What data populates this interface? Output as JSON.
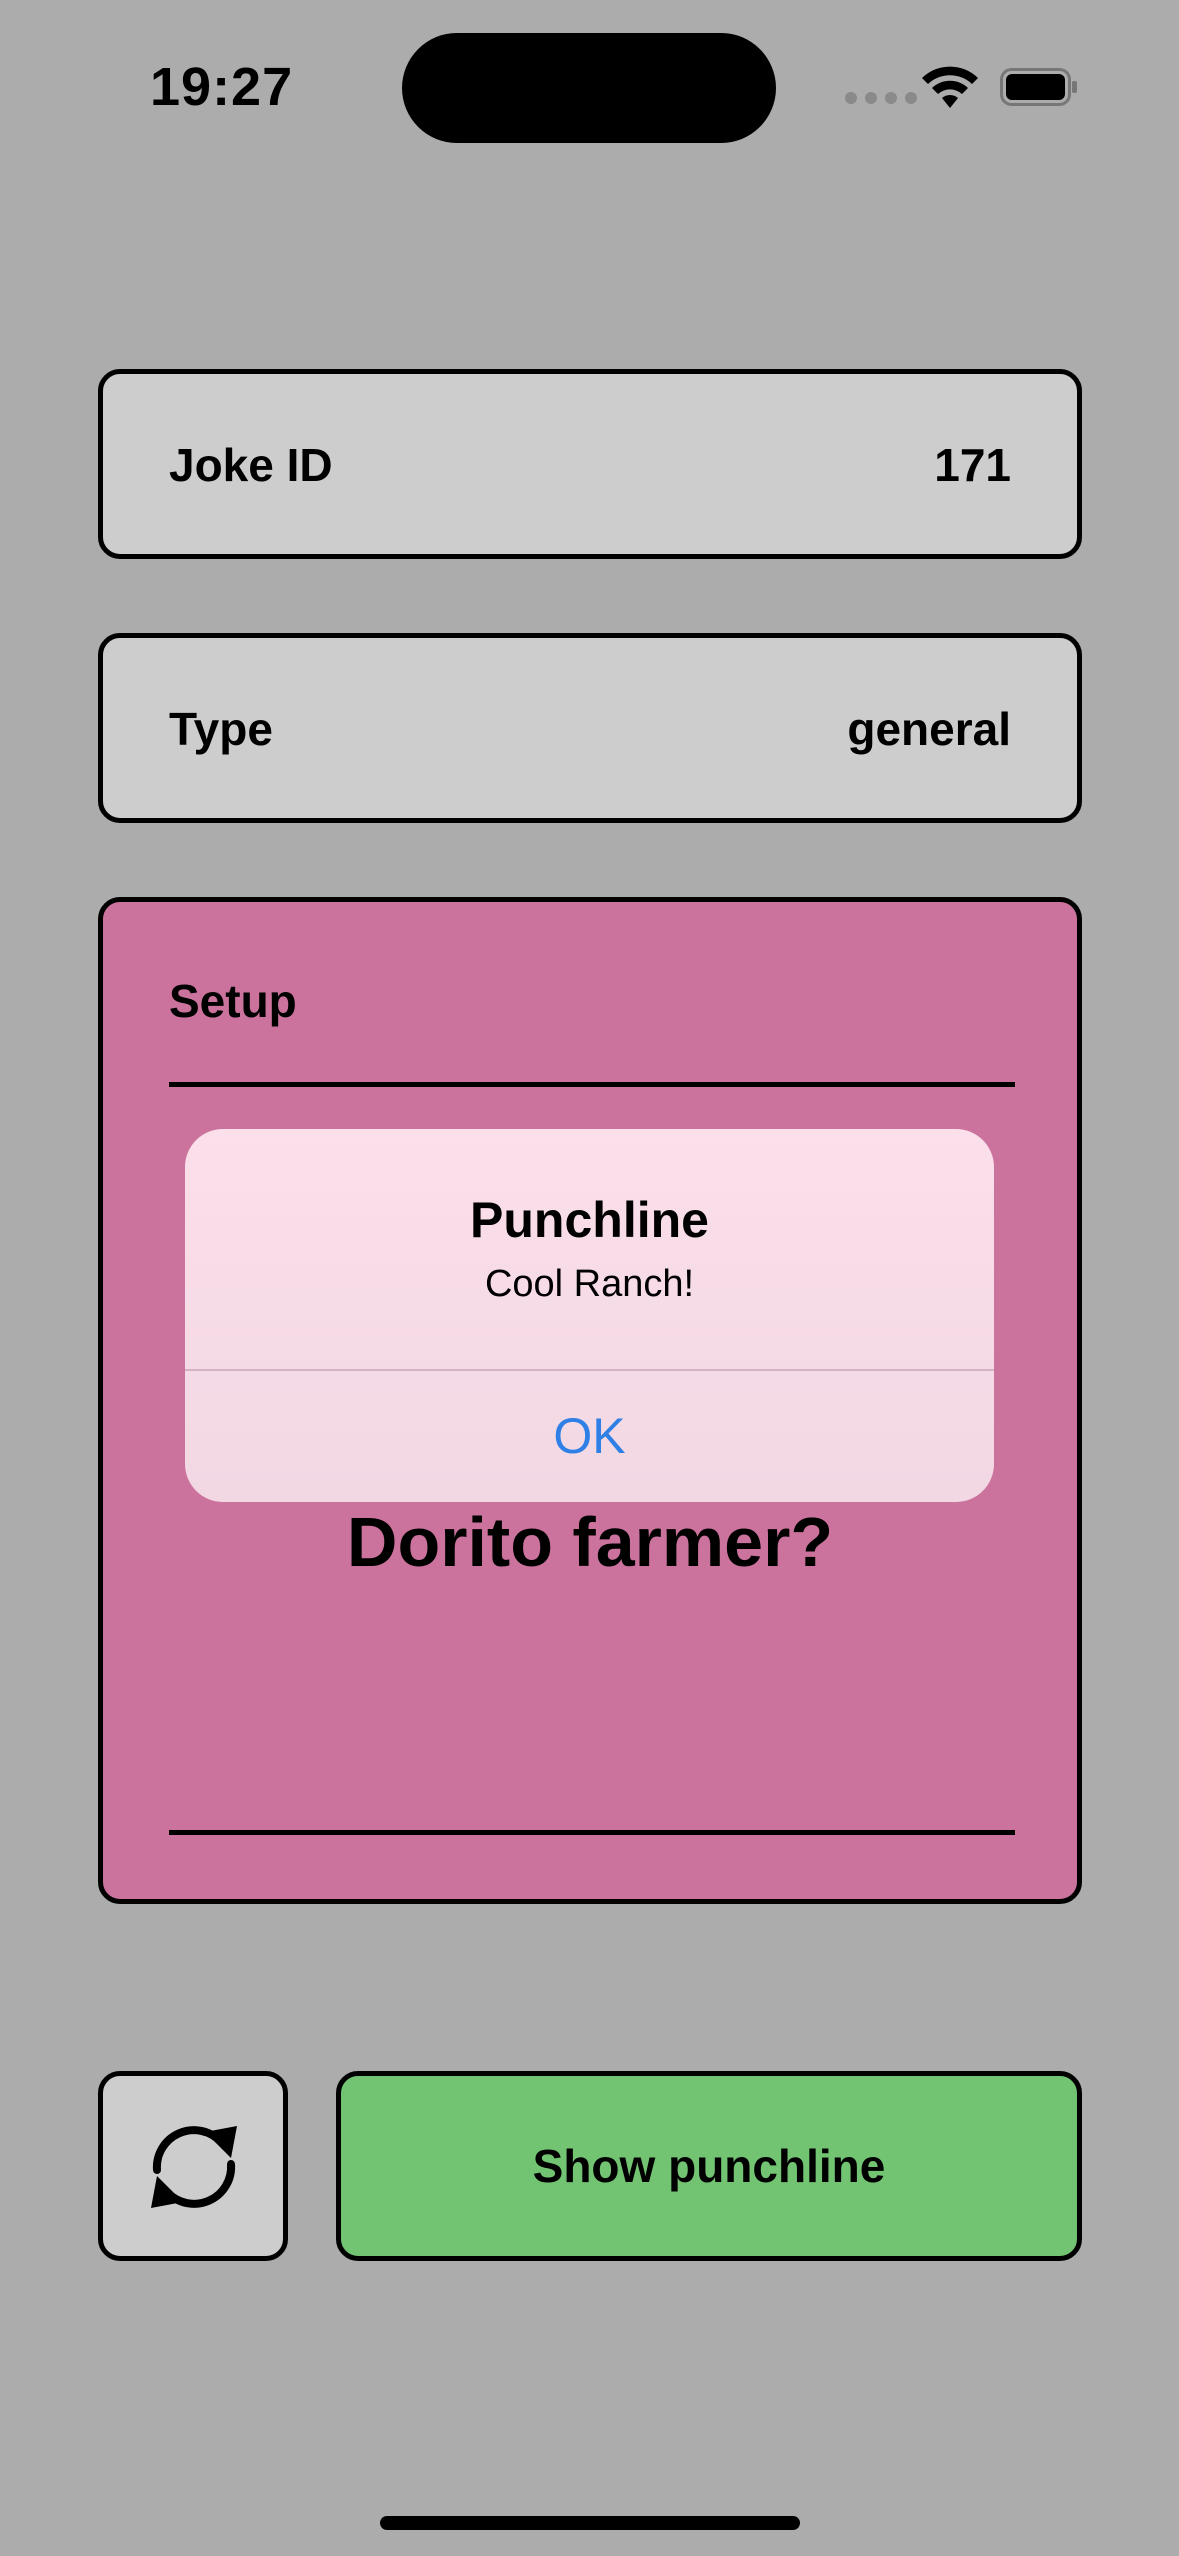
{
  "status_bar": {
    "time": "19:27"
  },
  "joke_id": {
    "label": "Joke ID",
    "value": "171"
  },
  "type": {
    "label": "Type",
    "value": "general"
  },
  "setup": {
    "label": "Setup",
    "text": "Dorito farmer?"
  },
  "buttons": {
    "refresh_icon": "refresh-icon",
    "show_punchline": "Show punchline"
  },
  "alert": {
    "title": "Punchline",
    "message": "Cool Ranch!",
    "ok_label": "OK"
  },
  "colors": {
    "background": "#acacac",
    "card": "#cdcdcd",
    "setup_card": "#cb729d",
    "punchline_button": "#72c472",
    "alert_link": "#2f80e6"
  }
}
